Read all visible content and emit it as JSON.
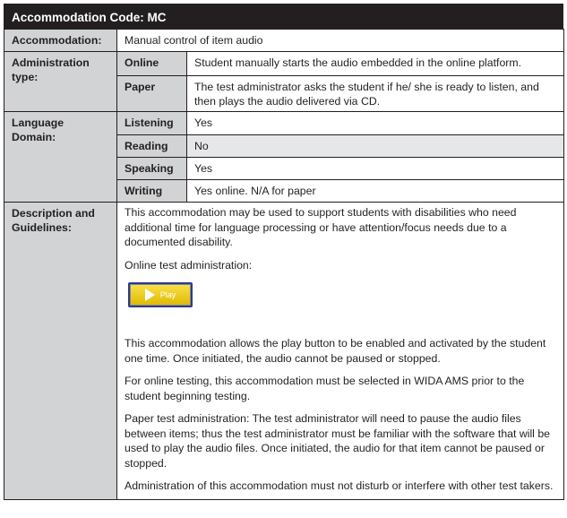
{
  "title": "Accommodation Code: MC",
  "accommodation": {
    "label": "Accommodation:",
    "value": "Manual control of item audio"
  },
  "administration": {
    "label": "Administration type:",
    "rows": [
      {
        "name": "Online",
        "value": "Student manually starts the audio embedded in the online platform."
      },
      {
        "name": "Paper",
        "value": "The test administrator asks the student if he/ she is ready to listen, and then plays the audio delivered via CD."
      }
    ]
  },
  "language_domain": {
    "label": "Language Domain:",
    "rows": [
      {
        "name": "Listening",
        "value": "Yes"
      },
      {
        "name": "Reading",
        "value": "No"
      },
      {
        "name": "Speaking",
        "value": "Yes"
      },
      {
        "name": "Writing",
        "value": "Yes online. N/A for paper"
      }
    ]
  },
  "description": {
    "label": "Description and Guidelines:",
    "p1": "This accommodation may be used to support students with disabilities who need additional time for language processing or have attention/focus needs due to a documented disability.",
    "p2": "Online test administration:",
    "play_label": "Play",
    "p3": "This accommodation allows the play button to be enabled and activated by the student one time. Once initiated, the audio cannot be paused or stopped.",
    "p4": "For online testing, this accommodation must be selected in WIDA AMS prior to the student beginning testing.",
    "p5": "Paper test administration: The test administrator will need to pause the audio files between items; thus the test administrator must be familiar with the software that will be used to play the audio files. Once initiated, the audio for that item cannot be paused or stopped.",
    "p6": "Administration of this accommodation must not disturb or interfere with other test takers."
  },
  "colors": {
    "header_bg": "#231f20",
    "label_bg": "#d1d3d4",
    "shaded_row_bg": "#e6e7e8",
    "play_button": "#f2d21b",
    "play_border": "#2b3a8f"
  }
}
